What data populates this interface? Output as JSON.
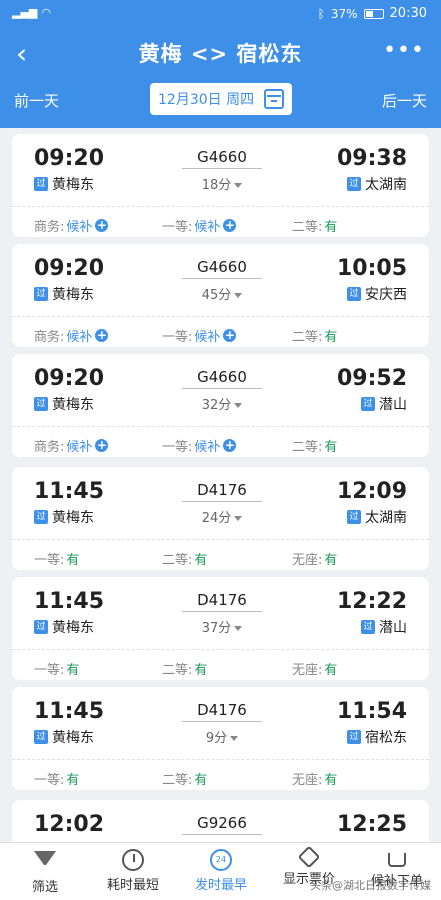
{
  "status": {
    "battery": "37%",
    "time": "20:30"
  },
  "header": {
    "title": "黄梅 <> 宿松东",
    "back_icon": "chevron-left-icon",
    "more_icon": "more-dots-icon",
    "prev_day": "前一天",
    "next_day": "后一天",
    "date": "12月30日  周四"
  },
  "badge": "过",
  "trains": [
    {
      "dep_time": "09:20",
      "train_no": "G4660",
      "duration": "18分",
      "arr_time": "09:38",
      "dep_station": "黄梅东",
      "arr_station": "太湖南",
      "seats": [
        {
          "label": "商务:",
          "value": "候补",
          "status": "waitlist"
        },
        {
          "label": "一等:",
          "value": "候补",
          "status": "waitlist"
        },
        {
          "label": "二等:",
          "value": "有",
          "status": "available"
        }
      ]
    },
    {
      "dep_time": "09:20",
      "train_no": "G4660",
      "duration": "45分",
      "arr_time": "10:05",
      "dep_station": "黄梅东",
      "arr_station": "安庆西",
      "seats": [
        {
          "label": "商务:",
          "value": "候补",
          "status": "waitlist"
        },
        {
          "label": "一等:",
          "value": "候补",
          "status": "waitlist"
        },
        {
          "label": "二等:",
          "value": "有",
          "status": "available"
        }
      ]
    },
    {
      "dep_time": "09:20",
      "train_no": "G4660",
      "duration": "32分",
      "arr_time": "09:52",
      "dep_station": "黄梅东",
      "arr_station": "潜山",
      "seats": [
        {
          "label": "商务:",
          "value": "候补",
          "status": "waitlist"
        },
        {
          "label": "一等:",
          "value": "候补",
          "status": "waitlist"
        },
        {
          "label": "二等:",
          "value": "有",
          "status": "available"
        }
      ]
    },
    {
      "dep_time": "11:45",
      "train_no": "D4176",
      "duration": "24分",
      "arr_time": "12:09",
      "dep_station": "黄梅东",
      "arr_station": "太湖南",
      "seats": [
        {
          "label": "一等:",
          "value": "有",
          "status": "available"
        },
        {
          "label": "二等:",
          "value": "有",
          "status": "available"
        },
        {
          "label": "无座:",
          "value": "有",
          "status": "available"
        }
      ]
    },
    {
      "dep_time": "11:45",
      "train_no": "D4176",
      "duration": "37分",
      "arr_time": "12:22",
      "dep_station": "黄梅东",
      "arr_station": "潜山",
      "seats": [
        {
          "label": "一等:",
          "value": "有",
          "status": "available"
        },
        {
          "label": "二等:",
          "value": "有",
          "status": "available"
        },
        {
          "label": "无座:",
          "value": "有",
          "status": "available"
        }
      ]
    },
    {
      "dep_time": "11:45",
      "train_no": "D4176",
      "duration": "9分",
      "arr_time": "11:54",
      "dep_station": "黄梅东",
      "arr_station": "宿松东",
      "seats": [
        {
          "label": "一等:",
          "value": "有",
          "status": "available"
        },
        {
          "label": "二等:",
          "value": "有",
          "status": "available"
        },
        {
          "label": "无座:",
          "value": "有",
          "status": "available"
        }
      ]
    },
    {
      "dep_time": "12:02",
      "train_no": "G9266",
      "duration": "",
      "arr_time": "12:25",
      "dep_station": "",
      "arr_station": "",
      "seats": []
    }
  ],
  "tabbar": [
    {
      "label": "筛选",
      "icon": "filter-icon"
    },
    {
      "label": "耗时最短",
      "icon": "stopwatch-icon"
    },
    {
      "label": "发时最早",
      "icon": "clock-24-icon",
      "icon_text": "24",
      "active": true
    },
    {
      "label": "显示票价",
      "icon": "price-tag-icon"
    },
    {
      "label": "候补下单",
      "icon": "cart-icon"
    }
  ],
  "watermark": "头条@湖北日报数字传媒",
  "colors": {
    "primary": "#3d8fe8",
    "available": "#1a9a5a",
    "waitlist": "#3d8fe8"
  }
}
